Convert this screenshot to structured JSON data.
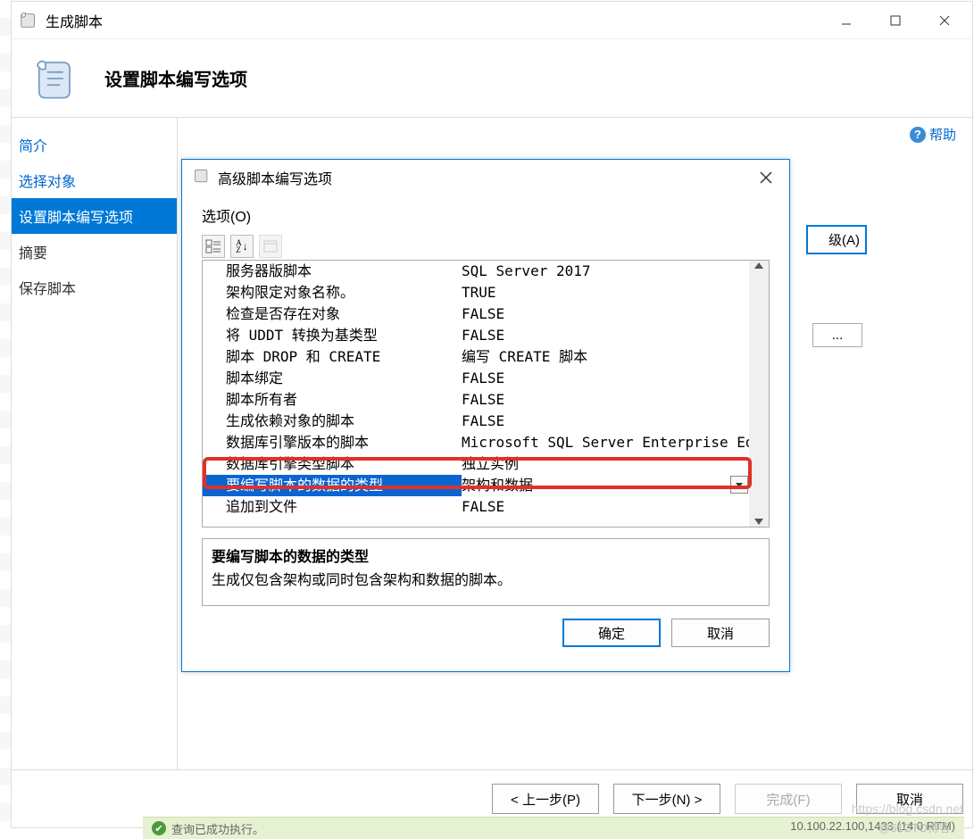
{
  "main": {
    "title": "生成脚本",
    "header_title": "设置脚本编写选项",
    "help_label": "帮助"
  },
  "sidebar": {
    "items": [
      {
        "label": "简介"
      },
      {
        "label": "选择对象"
      },
      {
        "label": "设置脚本编写选项"
      },
      {
        "label": "摘要"
      },
      {
        "label": "保存脚本"
      }
    ]
  },
  "back_buttons": {
    "advanced_suffix": "级(A)",
    "browse": "..."
  },
  "footer": {
    "prev": "< 上一步(P)",
    "next": "下一步(N) >",
    "finish": "完成(F)",
    "cancel": "取消"
  },
  "adv": {
    "title": "高级脚本编写选项",
    "options_label": "选项(O)",
    "grid": [
      {
        "k": "服务器版脚本",
        "v": "SQL Server 2017"
      },
      {
        "k": "架构限定对象名称。",
        "v": "TRUE"
      },
      {
        "k": "检查是否存在对象",
        "v": "FALSE"
      },
      {
        "k": "将 UDDT 转换为基类型",
        "v": "FALSE"
      },
      {
        "k": "脚本 DROP 和 CREATE",
        "v": "编写 CREATE 脚本"
      },
      {
        "k": "脚本绑定",
        "v": "FALSE"
      },
      {
        "k": "脚本所有者",
        "v": "FALSE"
      },
      {
        "k": "生成依赖对象的脚本",
        "v": "FALSE"
      },
      {
        "k": "数据库引擎版本的脚本",
        "v": "Microsoft SQL Server Enterprise Ed"
      },
      {
        "k": "数据库引擎类型脚本",
        "v": "独立实例"
      },
      {
        "k": "要编写脚本的数据的类型",
        "v": "架构和数据",
        "selected": true
      },
      {
        "k": "追加到文件",
        "v": "FALSE"
      }
    ],
    "desc_title": "要编写脚本的数据的类型",
    "desc_text": "生成仅包含架构或同时包含架构和数据的脚本。",
    "ok": "确定",
    "cancel": "取消"
  },
  "status": {
    "left_fragment": "查询已成功执行。",
    "right_fragment": "10.100.22.100,1433 (14.0 RTM)"
  },
  "watermark1": "https://blog.csdn.net",
  "watermark2": "@51CTO博客"
}
